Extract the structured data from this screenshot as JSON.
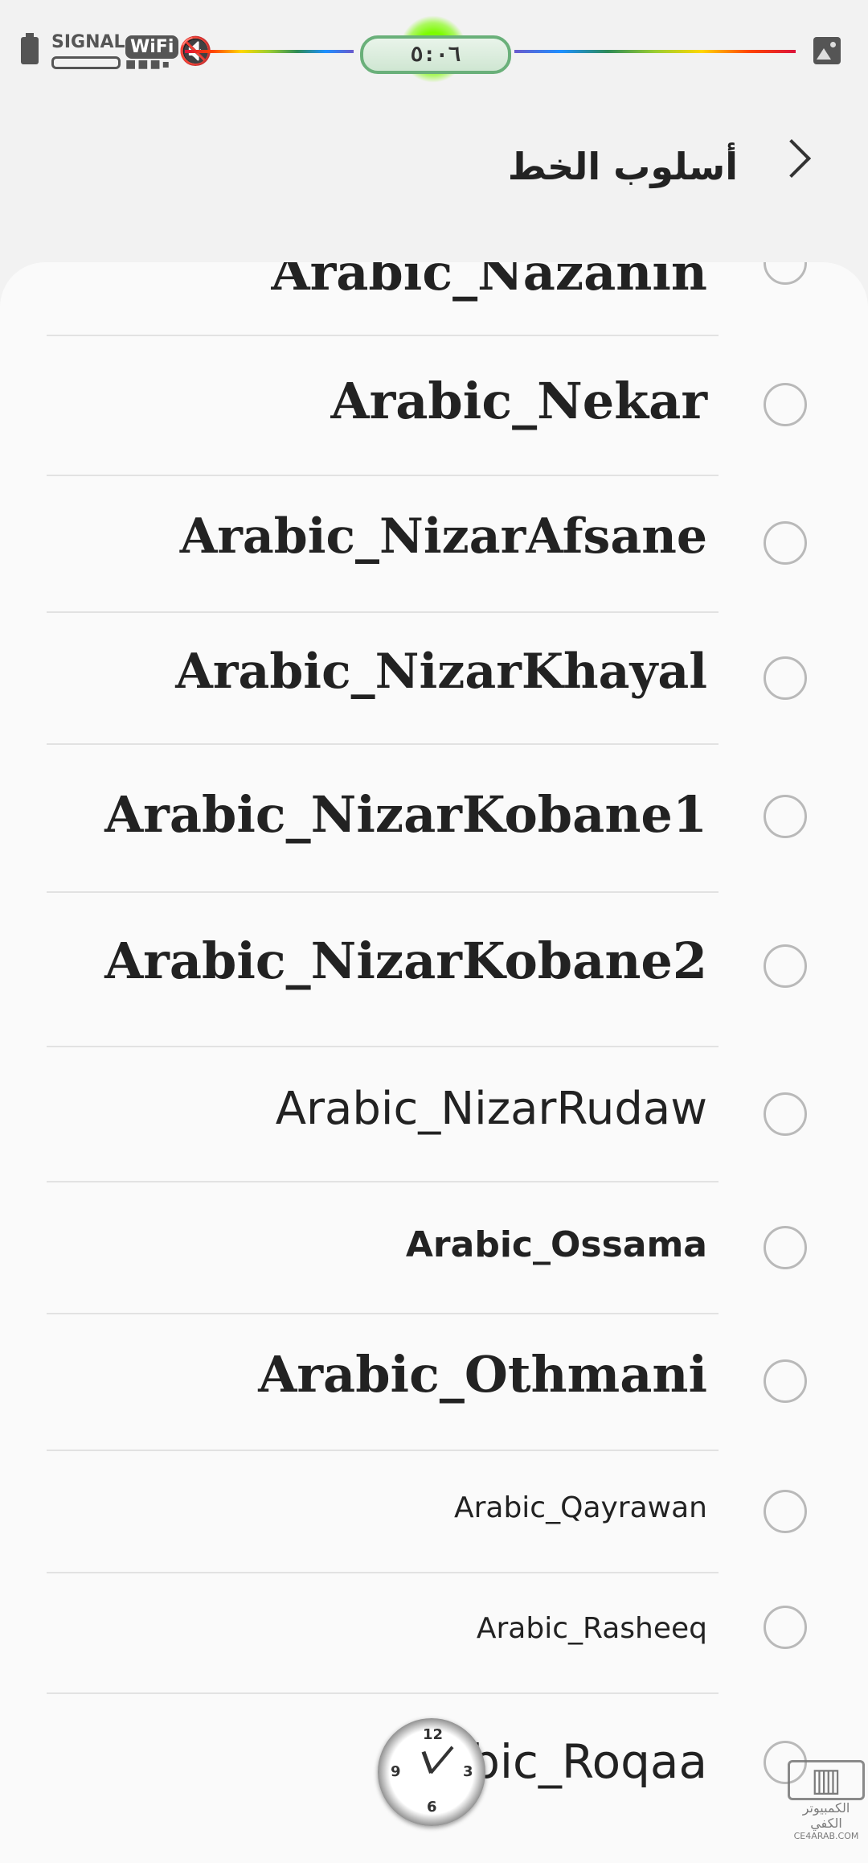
{
  "status_bar": {
    "signal_label": "SIGNAL",
    "wifi_label": "WiFi",
    "time": "٥:٠٦",
    "icons": [
      "battery-icon",
      "signal-icon",
      "wifi-icon",
      "mute-icon",
      "gallery-icon"
    ]
  },
  "header": {
    "title": "أسلوب الخط",
    "back_icon": "chevron-right-icon"
  },
  "fonts": [
    {
      "label": "Arabic_Nazanin",
      "selected": false
    },
    {
      "label": "Arabic_Nekar",
      "selected": false
    },
    {
      "label": "Arabic_NizarAfsane",
      "selected": false
    },
    {
      "label": "Arabic_NizarKhayal",
      "selected": false
    },
    {
      "label": "Arabic_NizarKobane1",
      "selected": false
    },
    {
      "label": "Arabic_NizarKobane2",
      "selected": false
    },
    {
      "label": "Arabic_NizarRudaw",
      "selected": false
    },
    {
      "label": "Arabic_Ossama",
      "selected": false
    },
    {
      "label": "Arabic_Othmani",
      "selected": false
    },
    {
      "label": "Arabic_Qayrawan",
      "selected": false
    },
    {
      "label": "Arabic_Rasheeq",
      "selected": false
    },
    {
      "label": "Arabic_Roqaa",
      "selected": false
    }
  ],
  "overlays": {
    "clock_numbers": [
      "12",
      "3",
      "6",
      "9"
    ],
    "watermark_ar": "الكمبيوتر الكفي",
    "watermark_en": "CE4ARAB.COM"
  }
}
